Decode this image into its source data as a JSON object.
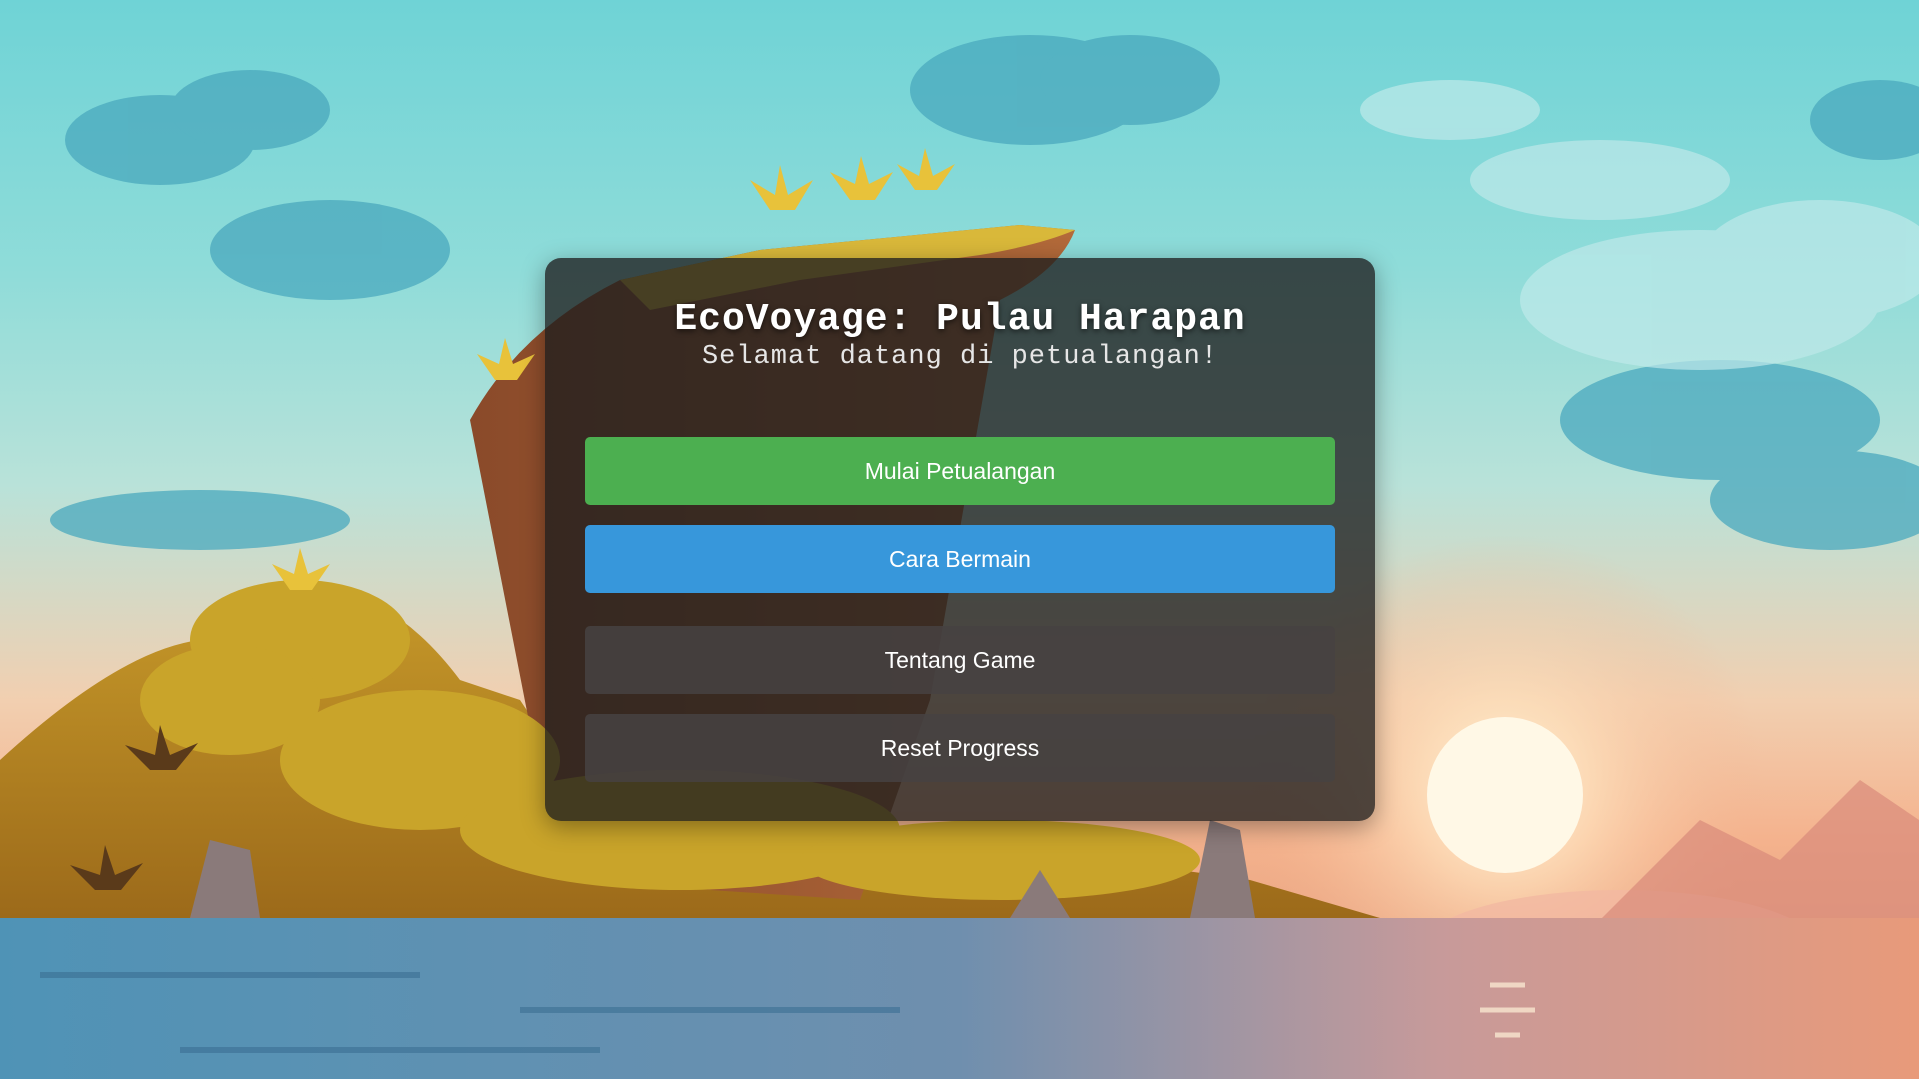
{
  "game": {
    "title": "EcoVoyage: Pulau Harapan",
    "subtitle": "Selamat datang di petualangan!"
  },
  "menu": {
    "start_label": "Mulai Petualangan",
    "howto_label": "Cara Bermain",
    "about_label": "Tentang Game",
    "reset_label": "Reset Progress"
  },
  "colors": {
    "start_button": "#4caf50",
    "howto_button": "#3797db",
    "panel": "#1e1e1e"
  }
}
